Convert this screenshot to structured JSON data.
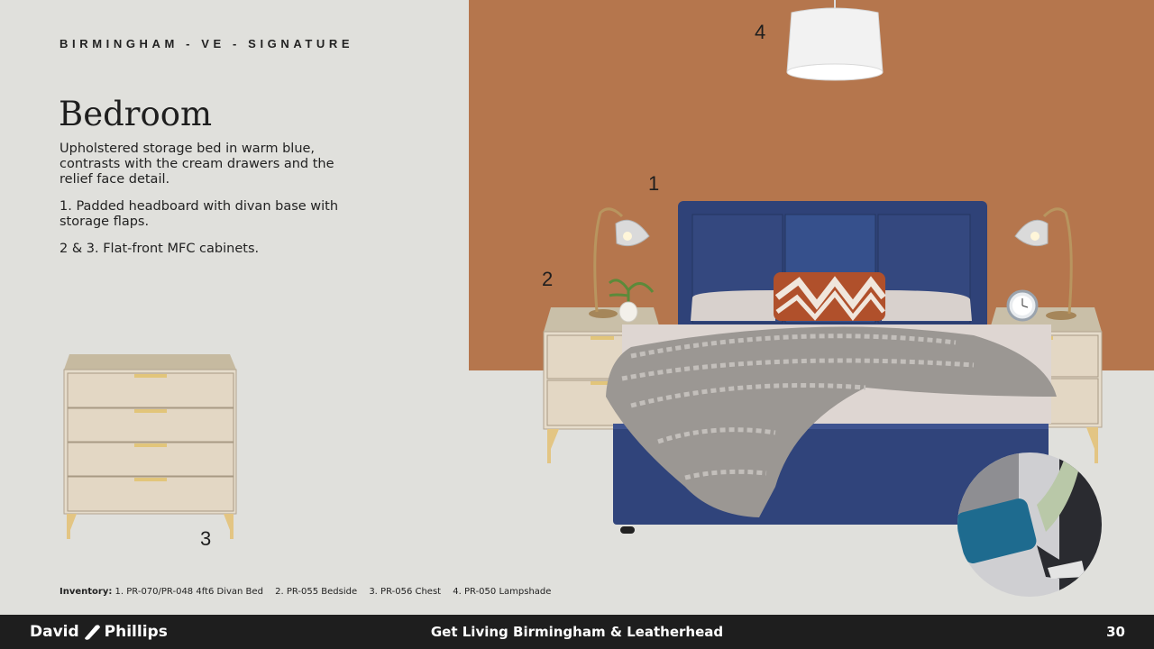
{
  "header": {
    "eyebrow": "BIRMINGHAM - VE - SIGNATURE",
    "title": "Bedroom"
  },
  "description": {
    "intro": "Upholstered storage bed in warm blue, contrasts with the cream drawers and the relief face detail.",
    "point1": "1. Padded headboard with divan base with storage flaps.",
    "point23": "2 & 3. Flat-front MFC cabinets."
  },
  "markers": {
    "m1": "1",
    "m2": "2",
    "m3": "3",
    "m4": "4"
  },
  "inventory": {
    "label": "Inventory:",
    "items": [
      "1. PR-070/PR-048 4ft6 Divan Bed",
      "2. PR-055 Bedside",
      "3. PR-056 Chest",
      "4. PR-050 Lampshade"
    ]
  },
  "footer": {
    "brand_first": "David",
    "brand_second": "Phillips",
    "center": "Get Living Birmingham & Leatherhead",
    "page": "30"
  },
  "colors": {
    "wall": "#b5764d",
    "background": "#e0e0dc",
    "bed_blue": "#2f4278",
    "cabinet": "#e3d8c6",
    "footer": "#1e1e1e"
  }
}
